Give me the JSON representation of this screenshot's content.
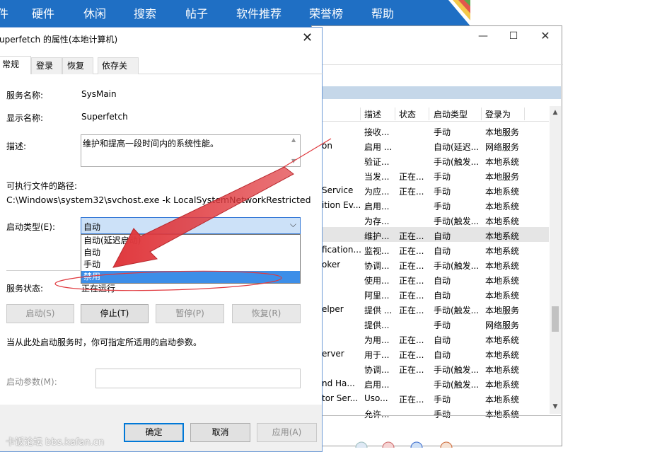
{
  "topnav": {
    "items": [
      "件",
      "硬件",
      "休闲",
      "搜索",
      "帖子",
      "软件推荐",
      "荣誉榜",
      "帮助"
    ],
    "bg_color": "#1f6fc4"
  },
  "services_window": {
    "minimize_icon": "minimize-icon",
    "maximize_icon": "maximize-icon",
    "close_icon": "close-icon",
    "columns": [
      "描述",
      "状态",
      "启动类型",
      "登录为"
    ],
    "rows": [
      {
        "name": "",
        "desc": "接收...",
        "status": "",
        "startup": "手动",
        "logon": "本地服务"
      },
      {
        "name": "on",
        "desc": "启用 ...",
        "status": "",
        "startup": "自动(延迟...",
        "logon": "网络服务"
      },
      {
        "name": "",
        "desc": "验证...",
        "status": "",
        "startup": "手动(触发...",
        "logon": "本地系统"
      },
      {
        "name": "",
        "desc": "当发...",
        "status": "正在...",
        "startup": "手动",
        "logon": "本地服务"
      },
      {
        "name": "Service",
        "desc": "为应...",
        "status": "正在...",
        "startup": "手动",
        "logon": "本地系统"
      },
      {
        "name": "ition Ev...",
        "desc": "启用...",
        "status": "",
        "startup": "手动",
        "logon": "本地系统"
      },
      {
        "name": "",
        "desc": "为存...",
        "status": "",
        "startup": "手动(触发...",
        "logon": "本地系统"
      },
      {
        "name": "",
        "desc": "维护...",
        "status": "正在...",
        "startup": "自动",
        "logon": "本地系统",
        "selected": true
      },
      {
        "name": "fication...",
        "desc": "监视...",
        "status": "正在...",
        "startup": "自动",
        "logon": "本地系统"
      },
      {
        "name": "oker",
        "desc": "协调...",
        "status": "正在...",
        "startup": "手动(触发...",
        "logon": "本地系统"
      },
      {
        "name": "",
        "desc": "使用...",
        "status": "正在...",
        "startup": "自动",
        "logon": "本地系统"
      },
      {
        "name": "",
        "desc": "阿里...",
        "status": "正在...",
        "startup": "自动",
        "logon": "本地系统"
      },
      {
        "name": "elper",
        "desc": "提供 ...",
        "status": "正在...",
        "startup": "手动(触发...",
        "logon": "本地服务"
      },
      {
        "name": "",
        "desc": "提供...",
        "status": "",
        "startup": "手动",
        "logon": "网络服务"
      },
      {
        "name": "",
        "desc": "为用...",
        "status": "正在...",
        "startup": "自动",
        "logon": "本地系统"
      },
      {
        "name": "erver",
        "desc": "用于...",
        "status": "正在...",
        "startup": "自动",
        "logon": "本地系统"
      },
      {
        "name": "",
        "desc": "协调...",
        "status": "正在...",
        "startup": "手动(触发...",
        "logon": "本地系统"
      },
      {
        "name": "nd Ha...",
        "desc": "启用...",
        "status": "",
        "startup": "手动(触发...",
        "logon": "本地系统"
      },
      {
        "name": "tor Ser...",
        "desc": "Uso...",
        "status": "正在...",
        "startup": "手动",
        "logon": "本地系统"
      },
      {
        "name": "",
        "desc": "允许...",
        "status": "",
        "startup": "手动",
        "logon": "本地系统"
      }
    ]
  },
  "dialog": {
    "title": "uperfetch 的属性(本地计算机)",
    "close_icon": "close-icon",
    "tabs": [
      "常规",
      "登录",
      "恢复",
      "依存关系"
    ],
    "service_name_label": "服务名称:",
    "service_name": "SysMain",
    "display_name_label": "显示名称:",
    "display_name": "Superfetch",
    "description_label": "描述:",
    "description": "维护和提高一段时间内的系统性能。",
    "exe_path_label": "可执行文件的路径:",
    "exe_path": "C:\\Windows\\system32\\svchost.exe -k LocalSystemNetworkRestricted",
    "startup_type_label": "启动类型(E):",
    "startup_type_value": "自动",
    "startup_options": [
      "自动(延迟启动)",
      "自动",
      "手动",
      "禁用"
    ],
    "highlighted_option": "禁用",
    "service_status_label": "服务状态:",
    "service_status": "正在运行",
    "buttons": {
      "start": "启动(S)",
      "stop": "停止(T)",
      "pause": "暂停(P)",
      "resume": "恢复(R)"
    },
    "hint": "当从此处启动服务时，你可指定所适用的启动参数。",
    "param_label": "启动参数(M):",
    "param_value": "",
    "footer": {
      "ok": "确定",
      "cancel": "取消",
      "apply": "应用(A)"
    }
  },
  "annotation": {
    "arrow_color": "#e0393e",
    "ellipse_color": "#e0393e"
  },
  "watermark": "卡饭论坛 bbs.kafan.cn"
}
